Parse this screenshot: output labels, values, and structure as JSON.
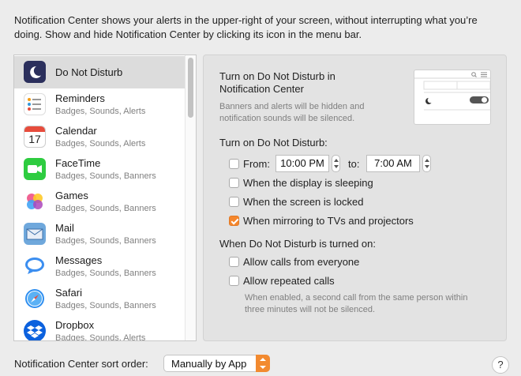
{
  "intro": {
    "line1": "Notification Center shows your alerts in the upper-right of your screen, without interrupting what you’re",
    "line2": "doing. Show and hide Notification Center by clicking its icon in the menu bar."
  },
  "apps": [
    {
      "name": "Do Not Disturb",
      "sub": "",
      "icon": "moon-icon",
      "selected": true
    },
    {
      "name": "Reminders",
      "sub": "Badges, Sounds, Alerts",
      "icon": "reminders-icon"
    },
    {
      "name": "Calendar",
      "sub": "Badges, Sounds, Alerts",
      "icon": "calendar-icon",
      "icon_text": "17"
    },
    {
      "name": "FaceTime",
      "sub": "Badges, Sounds, Banners",
      "icon": "facetime-icon"
    },
    {
      "name": "Games",
      "sub": "Badges, Sounds, Banners",
      "icon": "games-icon"
    },
    {
      "name": "Mail",
      "sub": "Badges, Sounds, Banners",
      "icon": "mail-icon"
    },
    {
      "name": "Messages",
      "sub": "Badges, Sounds, Banners",
      "icon": "messages-icon"
    },
    {
      "name": "Safari",
      "sub": "Badges, Sounds, Banners",
      "icon": "safari-icon"
    },
    {
      "name": "Dropbox",
      "sub": "Badges, Sounds, Alerts",
      "icon": "dropbox-icon"
    }
  ],
  "dnd": {
    "title_line1": "Turn on Do Not Disturb in",
    "title_line2": "Notification Center",
    "desc_line1": "Banners and alerts will be hidden and",
    "desc_line2": "notification sounds will be silenced.",
    "turn_on_heading": "Turn on Do Not Disturb:",
    "from_label": "From:",
    "from_time": "10:00 PM",
    "to_label": "to:",
    "to_time": "7:00 AM",
    "options": [
      {
        "label": "When the display is sleeping",
        "checked": false
      },
      {
        "label": "When the screen is locked",
        "checked": false
      },
      {
        "label": "When mirroring to TVs and projectors",
        "checked": true
      }
    ],
    "when_on_heading": "When Do Not Disturb is turned on:",
    "calls": [
      {
        "label": "Allow calls from everyone",
        "checked": false
      },
      {
        "label": "Allow repeated calls",
        "checked": false
      }
    ],
    "note_line1": "When enabled, a second call from the same person within",
    "note_line2": "three minutes will not be silenced."
  },
  "footer": {
    "sort_label": "Notification Center sort order:",
    "sort_value": "Manually by App",
    "help": "?"
  },
  "colors": {
    "accent": "#f5862c",
    "selection": "#dcdcdc"
  }
}
